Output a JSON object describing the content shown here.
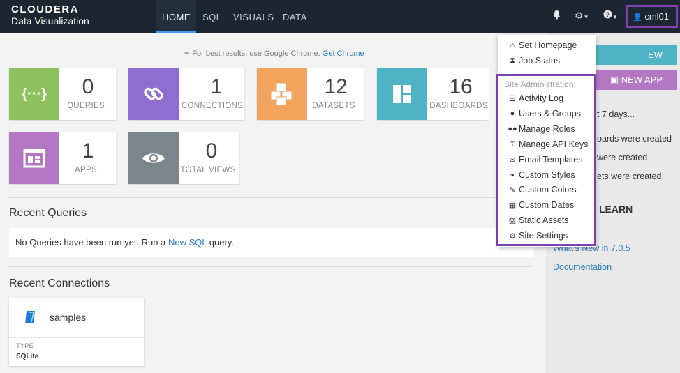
{
  "brand": {
    "line1": "CLOUDERA",
    "line2": "Data Visualization"
  },
  "nav": {
    "tabs": [
      "HOME",
      "SQL",
      "VISUALS",
      "DATA"
    ],
    "active": "HOME",
    "user": "cml01"
  },
  "hint": {
    "text": "For best results, use Google Chrome.",
    "link": "Get Chrome"
  },
  "stats": [
    {
      "value": "0",
      "label": "QUERIES",
      "color": "#8fc25e",
      "icon": "braces-icon"
    },
    {
      "value": "1",
      "label": "CONNECTIONS",
      "color": "#8e6fd1",
      "icon": "link-icon"
    },
    {
      "value": "12",
      "label": "DATASETS",
      "color": "#f2a45f",
      "icon": "cubes-icon"
    },
    {
      "value": "16",
      "label": "DASHBOARDS",
      "color": "#4fb3c6",
      "icon": "dashboard-icon"
    },
    {
      "value": "1",
      "label": "APPS",
      "color": "#b477c4",
      "icon": "app-icon"
    },
    {
      "value": "0",
      "label": "TOTAL VIEWS",
      "color": "#7b858c",
      "icon": "eye-icon"
    }
  ],
  "recent_queries": {
    "title": "Recent Queries",
    "empty_prefix": "No Queries have been run yet. Run a",
    "link": "New SQL",
    "empty_suffix": "query."
  },
  "recent_connections": {
    "title": "Recent Connections",
    "card": {
      "name": "samples",
      "type_label": "TYPE",
      "type_value": "SQLite"
    }
  },
  "right_panel": {
    "new_dashboard": "EW DASHBOARD",
    "new_app": "NEW APP",
    "last_days": "t 7 days...",
    "activity": [
      "oards were created",
      "were created",
      "ets were created"
    ],
    "learn_title": "LEARN",
    "links": [
      "What's New in 7.0.5",
      "Documentation"
    ],
    "colors": {
      "dashboard_btn": "#4fb3c6",
      "app_btn": "#b477c4"
    }
  },
  "dropdown": {
    "top_items": [
      {
        "label": "Set Homepage",
        "icon": "home-icon"
      },
      {
        "label": "Job Status",
        "icon": "hourglass-icon"
      }
    ],
    "section_header": "Site Administration:",
    "admin_items": [
      {
        "label": "Activity Log",
        "icon": "list-icon"
      },
      {
        "label": "Users & Groups",
        "icon": "user-icon"
      },
      {
        "label": "Manage Roles",
        "icon": "users-icon"
      },
      {
        "label": "Manage API Keys",
        "icon": "key-icon"
      },
      {
        "label": "Email Templates",
        "icon": "envelope-icon"
      },
      {
        "label": "Custom Styles",
        "icon": "leaf-icon"
      },
      {
        "label": "Custom Colors",
        "icon": "brush-icon"
      },
      {
        "label": "Custom Dates",
        "icon": "calendar-icon"
      },
      {
        "label": "Static Assets",
        "icon": "file-image-icon"
      },
      {
        "label": "Site Settings",
        "icon": "gears-icon"
      }
    ]
  }
}
